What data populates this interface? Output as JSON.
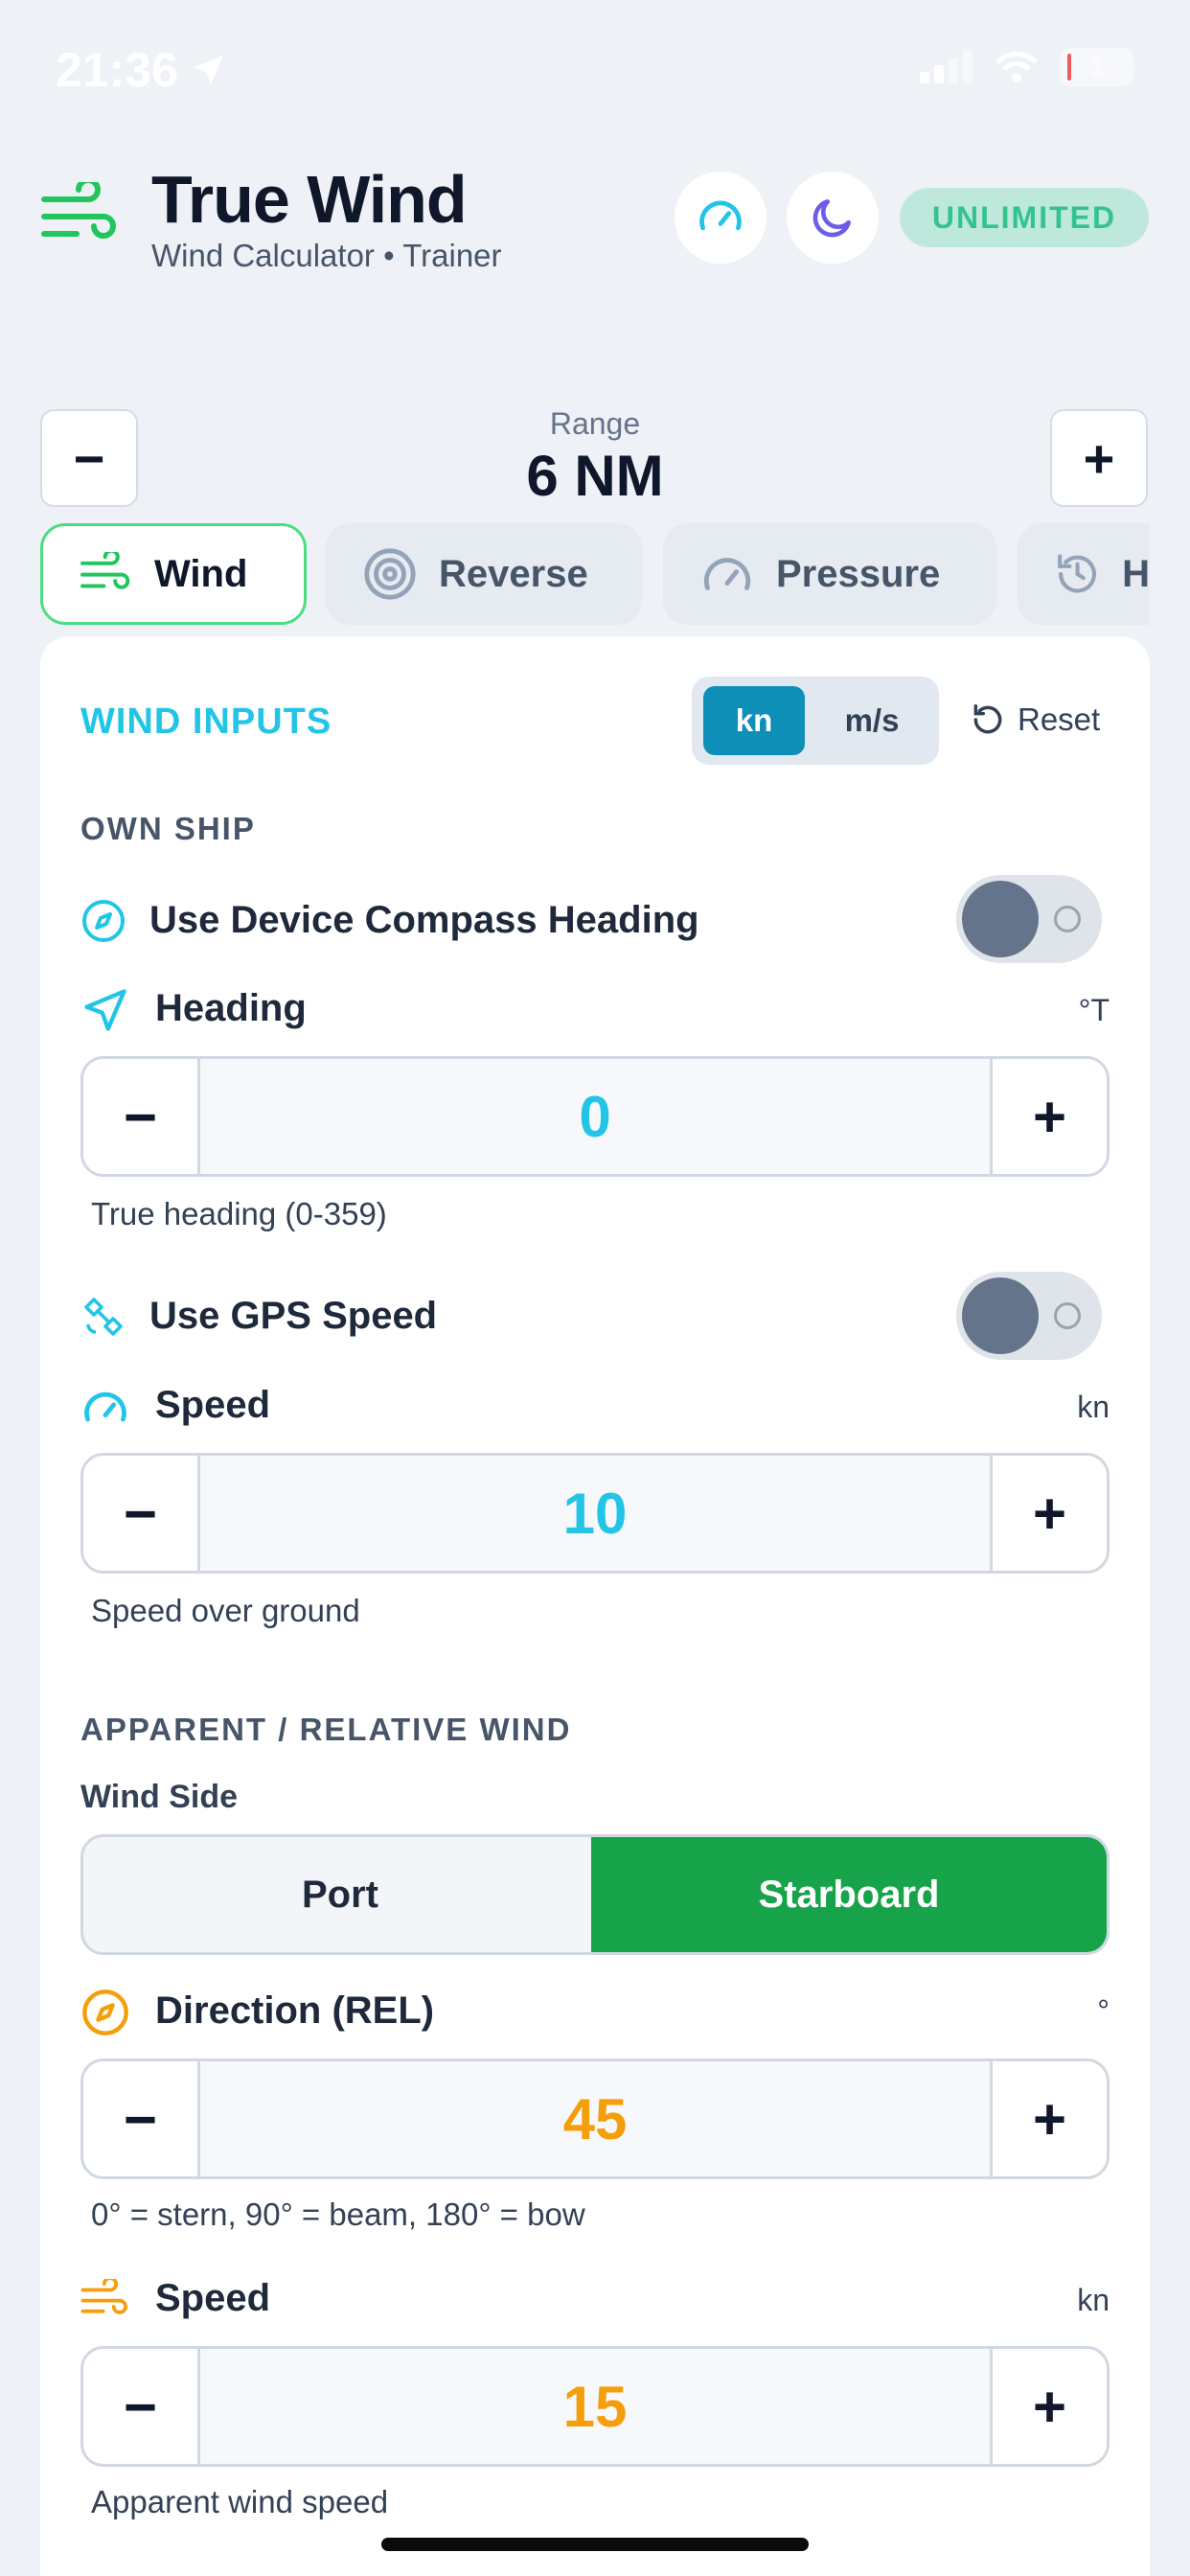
{
  "status_bar": {
    "time": "21:36",
    "battery": "1"
  },
  "header": {
    "title": "True Wind",
    "subtitle": "Wind Calculator • Trainer",
    "badge": "UNLIMITED"
  },
  "range": {
    "label": "Range",
    "value": "6 NM",
    "minus": "−",
    "plus": "+"
  },
  "tabs": [
    {
      "label": "Wind",
      "icon": "wind-icon",
      "active": true
    },
    {
      "label": "Reverse",
      "icon": "target-icon",
      "active": false
    },
    {
      "label": "Pressure",
      "icon": "gauge-icon",
      "active": false
    },
    {
      "label": "H",
      "icon": "history-icon",
      "active": false
    }
  ],
  "wind_inputs": {
    "title": "WIND INPUTS",
    "units": {
      "selected": "kn",
      "other": "m/s"
    },
    "reset_label": "Reset"
  },
  "own_ship": {
    "title": "OWN SHIP",
    "compass_toggle_label": "Use Device Compass Heading",
    "compass_toggle_on": false,
    "heading": {
      "label": "Heading",
      "unit": "°T",
      "value": "0",
      "hint": "True heading (0-359)"
    },
    "gps_toggle_label": "Use GPS Speed",
    "gps_toggle_on": false,
    "speed": {
      "label": "Speed",
      "unit": "kn",
      "value": "10",
      "hint": "Speed over ground"
    }
  },
  "apparent_wind": {
    "title": "APPARENT / RELATIVE WIND",
    "side_label": "Wind Side",
    "side_options": [
      "Port",
      "Starboard"
    ],
    "side_selected": "Starboard",
    "direction": {
      "label": "Direction (REL)",
      "unit": "°",
      "value": "45",
      "hint": "0° = stern, 90° = beam, 180° = bow"
    },
    "speed": {
      "label": "Speed",
      "unit": "kn",
      "value": "15",
      "hint": "Apparent wind speed"
    }
  },
  "stepper": {
    "minus": "−",
    "plus": "+"
  },
  "colors": {
    "accent_cyan": "#22c5e6",
    "accent_orange": "#f59e0b",
    "starboard_green": "#16a34a",
    "tab_active_border": "#4ade80",
    "unit_selected": "#0e8fb8"
  }
}
